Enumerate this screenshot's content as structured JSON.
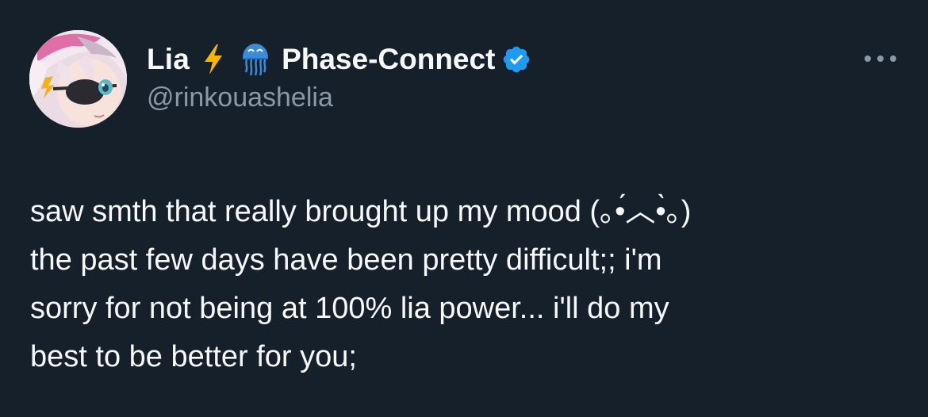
{
  "tweet": {
    "display_name": "Lia",
    "affiliation": "Phase-Connect",
    "handle": "@rinkouashelia",
    "text_lines": [
      "saw smth that really brought up my mood (｡•́︿•̀｡)",
      "the past few days have been pretty difficult;; i'm",
      "sorry for not being at 100% lia power... i'll do my",
      "best to be better for you;"
    ]
  },
  "icons": {
    "avatar": "avatar",
    "lightning": "lightning-emoji-icon",
    "jellyfish": "jellyfish-emoji-icon",
    "verified": "verified-badge-icon",
    "more": "more-options-icon"
  },
  "colors": {
    "background": "#15202b",
    "text": "#f7f9f9",
    "secondary_text": "#8b98a5",
    "verified_blue": "#1d9bf0",
    "lightning_yellow": "#f7b500",
    "jellyfish_blue": "#3a8bd8"
  }
}
